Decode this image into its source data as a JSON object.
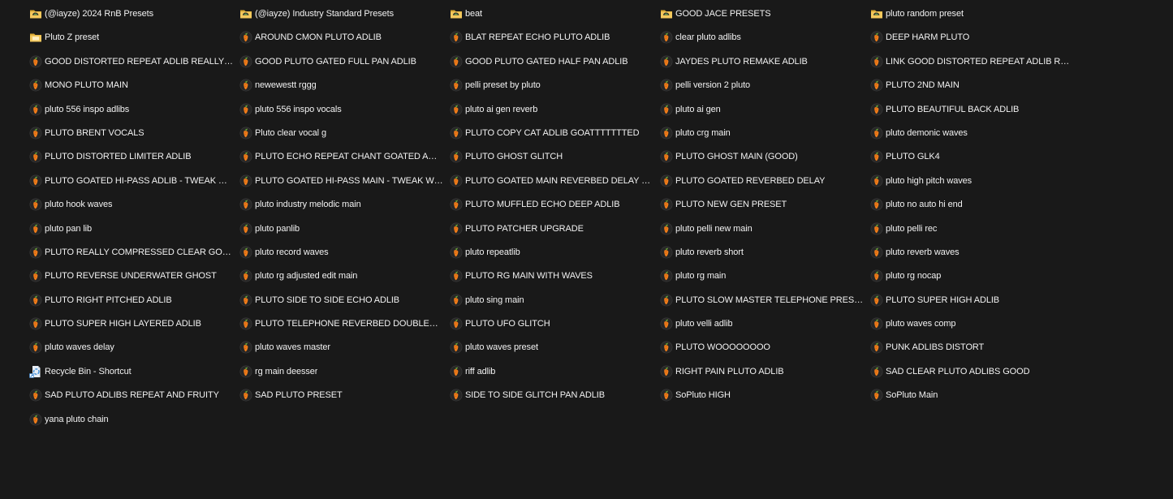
{
  "window": {
    "view": "List view (file explorer, dark theme)"
  },
  "colors": {
    "background": "#191919",
    "text": "#f2f2f2",
    "folder": "#f2c94c",
    "fl_orange": "#f07d1a",
    "fl_leaf": "#6ca83a"
  },
  "columns": [
    {
      "items": [
        {
          "name": "(@iayze) 2024 RnB Presets",
          "icon": "folder-special-icon"
        },
        {
          "name": "Pluto Z preset",
          "icon": "folder-icon"
        },
        {
          "name": "GOOD DISTORTED REPEAT ADLIB REALLY GO...",
          "icon": "fl-studio-preset-icon"
        },
        {
          "name": "MONO PLUTO MAIN",
          "icon": "fl-studio-preset-icon"
        },
        {
          "name": "pluto 556 inspo adlibs",
          "icon": "fl-studio-preset-icon"
        },
        {
          "name": "PLUTO BRENT VOCALS",
          "icon": "fl-studio-preset-icon"
        },
        {
          "name": "PLUTO DISTORTED LIMITER ADLIB",
          "icon": "fl-studio-preset-icon"
        },
        {
          "name": "PLUTO GOATED HI-PASS ADLIB - TWEAK WIT...",
          "icon": "fl-studio-preset-icon"
        },
        {
          "name": "pluto hook waves",
          "icon": "fl-studio-preset-icon"
        },
        {
          "name": "pluto pan lib",
          "icon": "fl-studio-preset-icon"
        },
        {
          "name": "PLUTO REALLY COMPRESSED CLEAR GOOD ...",
          "icon": "fl-studio-preset-icon"
        },
        {
          "name": "PLUTO REVERSE UNDERWATER GHOST",
          "icon": "fl-studio-preset-icon"
        },
        {
          "name": "PLUTO RIGHT PITCHED ADLIB",
          "icon": "fl-studio-preset-icon"
        },
        {
          "name": "PLUTO SUPER HIGH LAYERED ADLIB",
          "icon": "fl-studio-preset-icon"
        },
        {
          "name": "pluto waves delay",
          "icon": "fl-studio-preset-icon"
        },
        {
          "name": "Recycle Bin - Shortcut",
          "icon": "recycle-bin-shortcut-icon"
        },
        {
          "name": "SAD PLUTO ADLIBS REPEAT AND FRUITY",
          "icon": "fl-studio-preset-icon"
        },
        {
          "name": "yana pluto chain",
          "icon": "fl-studio-preset-icon"
        }
      ]
    },
    {
      "items": [
        {
          "name": "(@iayze) Industry Standard Presets",
          "icon": "folder-special-icon"
        },
        {
          "name": "AROUND CMON PLUTO ADLIB",
          "icon": "fl-studio-preset-icon"
        },
        {
          "name": "GOOD PLUTO GATED FULL PAN ADLIB",
          "icon": "fl-studio-preset-icon"
        },
        {
          "name": "newewestt rggg",
          "icon": "fl-studio-preset-icon"
        },
        {
          "name": "pluto 556 inspo vocals",
          "icon": "fl-studio-preset-icon"
        },
        {
          "name": "Pluto clear vocal g",
          "icon": "fl-studio-preset-icon"
        },
        {
          "name": "PLUTO ECHO REPEAT CHANT GOATED ADLIB",
          "icon": "fl-studio-preset-icon"
        },
        {
          "name": "PLUTO GOATED HI-PASS MAIN - TWEAK WIT...",
          "icon": "fl-studio-preset-icon"
        },
        {
          "name": "pluto industry melodic main",
          "icon": "fl-studio-preset-icon"
        },
        {
          "name": "pluto panlib",
          "icon": "fl-studio-preset-icon"
        },
        {
          "name": "pluto record waves",
          "icon": "fl-studio-preset-icon"
        },
        {
          "name": "pluto rg adjusted edit main",
          "icon": "fl-studio-preset-icon"
        },
        {
          "name": "PLUTO SIDE TO SIDE ECHO ADLIB",
          "icon": "fl-studio-preset-icon"
        },
        {
          "name": "PLUTO TELEPHONE REVERBED DOUBLED AD...",
          "icon": "fl-studio-preset-icon"
        },
        {
          "name": "pluto waves master",
          "icon": "fl-studio-preset-icon"
        },
        {
          "name": "rg main deesser",
          "icon": "fl-studio-preset-icon"
        },
        {
          "name": "SAD PLUTO PRESET",
          "icon": "fl-studio-preset-icon"
        }
      ]
    },
    {
      "items": [
        {
          "name": "beat",
          "icon": "folder-special-icon"
        },
        {
          "name": "BLAT REPEAT ECHO PLUTO ADLIB",
          "icon": "fl-studio-preset-icon"
        },
        {
          "name": "GOOD PLUTO GATED HALF PAN ADLIB",
          "icon": "fl-studio-preset-icon"
        },
        {
          "name": "pelli preset by pluto",
          "icon": "fl-studio-preset-icon"
        },
        {
          "name": "pluto ai gen reverb",
          "icon": "fl-studio-preset-icon"
        },
        {
          "name": "PLUTO COPY CAT ADLIB GOATTTTTTTED",
          "icon": "fl-studio-preset-icon"
        },
        {
          "name": "PLUTO GHOST GLITCH",
          "icon": "fl-studio-preset-icon"
        },
        {
          "name": "PLUTO GOATED MAIN REVERBED DELAY high",
          "icon": "fl-studio-preset-icon"
        },
        {
          "name": "PLUTO MUFFLED ECHO DEEP ADLIB",
          "icon": "fl-studio-preset-icon"
        },
        {
          "name": "PLUTO PATCHER UPGRADE",
          "icon": "fl-studio-preset-icon"
        },
        {
          "name": "pluto repeatlib",
          "icon": "fl-studio-preset-icon"
        },
        {
          "name": "PLUTO RG MAIN WITH WAVES",
          "icon": "fl-studio-preset-icon"
        },
        {
          "name": "pluto sing main",
          "icon": "fl-studio-preset-icon"
        },
        {
          "name": "PLUTO UFO GLITCH",
          "icon": "fl-studio-preset-icon"
        },
        {
          "name": "pluto waves preset",
          "icon": "fl-studio-preset-icon"
        },
        {
          "name": "riff adlib",
          "icon": "fl-studio-preset-icon"
        },
        {
          "name": "SIDE TO SIDE GLITCH PAN ADLIB",
          "icon": "fl-studio-preset-icon"
        }
      ]
    },
    {
      "items": [
        {
          "name": "GOOD JACE PRESETS",
          "icon": "folder-special-icon"
        },
        {
          "name": "clear pluto adlibs",
          "icon": "fl-studio-preset-icon"
        },
        {
          "name": "JAYDES PLUTO REMAKE ADLIB",
          "icon": "fl-studio-preset-icon"
        },
        {
          "name": "pelli version 2 pluto",
          "icon": "fl-studio-preset-icon"
        },
        {
          "name": "pluto ai gen",
          "icon": "fl-studio-preset-icon"
        },
        {
          "name": "pluto crg main",
          "icon": "fl-studio-preset-icon"
        },
        {
          "name": "PLUTO GHOST MAIN (GOOD)",
          "icon": "fl-studio-preset-icon"
        },
        {
          "name": "PLUTO GOATED REVERBED DELAY",
          "icon": "fl-studio-preset-icon"
        },
        {
          "name": "PLUTO NEW GEN PRESET",
          "icon": "fl-studio-preset-icon"
        },
        {
          "name": "pluto pelli new main",
          "icon": "fl-studio-preset-icon"
        },
        {
          "name": "pluto reverb short",
          "icon": "fl-studio-preset-icon"
        },
        {
          "name": "pluto rg main",
          "icon": "fl-studio-preset-icon"
        },
        {
          "name": "PLUTO SLOW MASTER TELEPHONE PRESET",
          "icon": "fl-studio-preset-icon"
        },
        {
          "name": "pluto velli adlib",
          "icon": "fl-studio-preset-icon"
        },
        {
          "name": "PLUTO WOOOOOOOO",
          "icon": "fl-studio-preset-icon"
        },
        {
          "name": "RIGHT PAIN PLUTO ADLIB",
          "icon": "fl-studio-preset-icon"
        },
        {
          "name": "SoPluto HIGH",
          "icon": "fl-studio-preset-icon"
        }
      ]
    },
    {
      "items": [
        {
          "name": "pluto random preset",
          "icon": "folder-special-icon"
        },
        {
          "name": "DEEP HARM PLUTO",
          "icon": "fl-studio-preset-icon"
        },
        {
          "name": "LINK  GOOD DISTORTED REPEAT ADLIB REAL...",
          "icon": "fl-studio-preset-icon"
        },
        {
          "name": "PLUTO 2ND MAIN",
          "icon": "fl-studio-preset-icon"
        },
        {
          "name": "PLUTO BEAUTIFUL BACK ADLIB",
          "icon": "fl-studio-preset-icon"
        },
        {
          "name": "pluto demonic waves",
          "icon": "fl-studio-preset-icon"
        },
        {
          "name": "PLUTO GLK4",
          "icon": "fl-studio-preset-icon"
        },
        {
          "name": "pluto high pitch waves",
          "icon": "fl-studio-preset-icon"
        },
        {
          "name": "pluto no auto hi end",
          "icon": "fl-studio-preset-icon"
        },
        {
          "name": "pluto pelli rec",
          "icon": "fl-studio-preset-icon"
        },
        {
          "name": "pluto reverb waves",
          "icon": "fl-studio-preset-icon"
        },
        {
          "name": "pluto rg nocap",
          "icon": "fl-studio-preset-icon"
        },
        {
          "name": "PLUTO SUPER HIGH ADLIB",
          "icon": "fl-studio-preset-icon"
        },
        {
          "name": "pluto waves comp",
          "icon": "fl-studio-preset-icon"
        },
        {
          "name": "PUNK ADLIBS DISTORT",
          "icon": "fl-studio-preset-icon"
        },
        {
          "name": "SAD CLEAR PLUTO ADLIBS GOOD",
          "icon": "fl-studio-preset-icon"
        },
        {
          "name": "SoPluto Main",
          "icon": "fl-studio-preset-icon"
        }
      ]
    }
  ]
}
